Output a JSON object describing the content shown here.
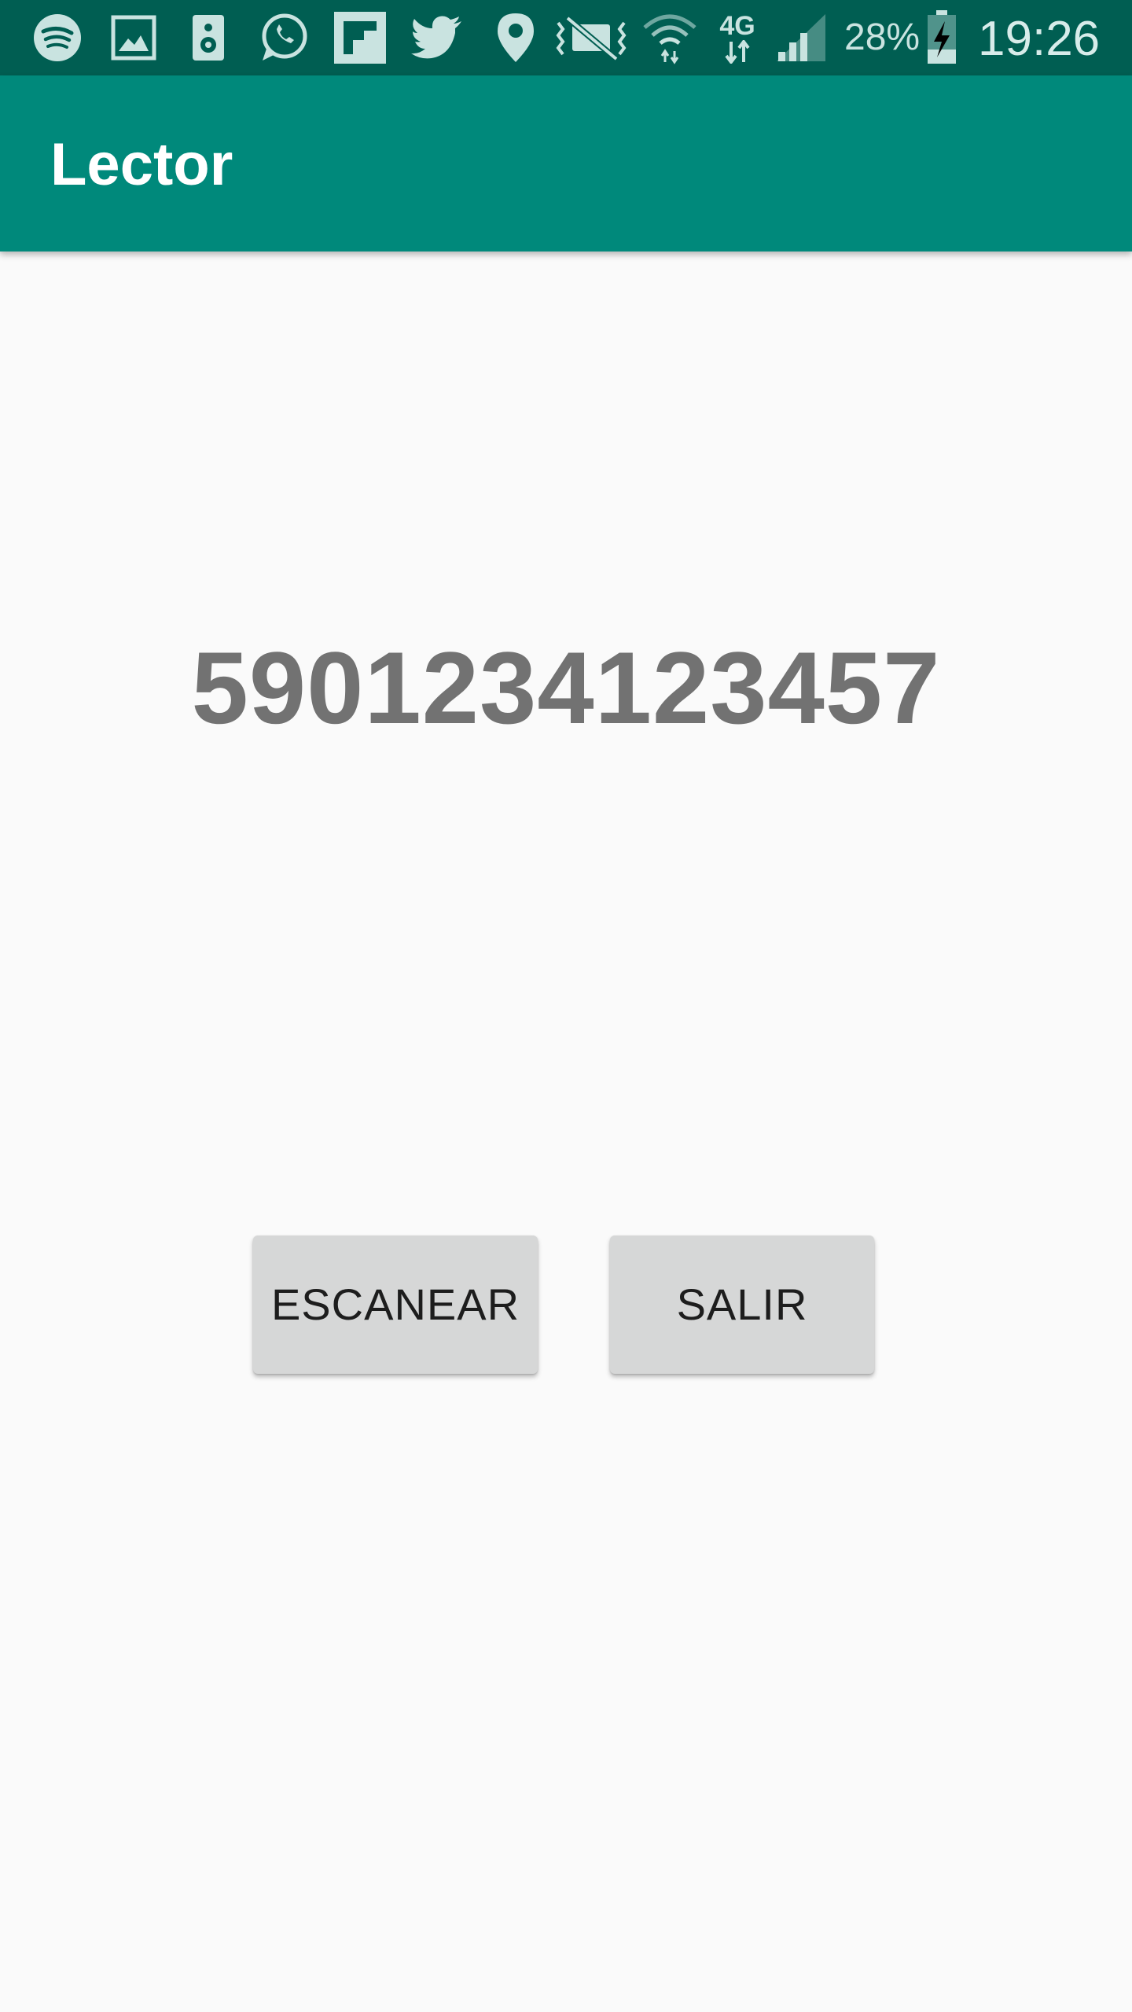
{
  "status_bar": {
    "icons": [
      "spotify-icon",
      "gallery-icon",
      "speaker-icon",
      "whatsapp-icon",
      "flipboard-icon",
      "twitter-icon",
      "location-icon",
      "vibrate-mute-icon",
      "wifi-icon",
      "network-4g-icon",
      "signal-icon"
    ],
    "network_label": "4G",
    "battery_percent": "28%",
    "time": "19:26"
  },
  "app_bar": {
    "title": "Lector"
  },
  "main": {
    "scan_result": "5901234123457",
    "scan_button_label": "ESCANEAR",
    "exit_button_label": "SALIR"
  },
  "colors": {
    "status_bar": "#005e52",
    "app_bar": "#00897b",
    "background": "#fafafa",
    "button": "#d6d7d7",
    "result_text": "#727272"
  }
}
